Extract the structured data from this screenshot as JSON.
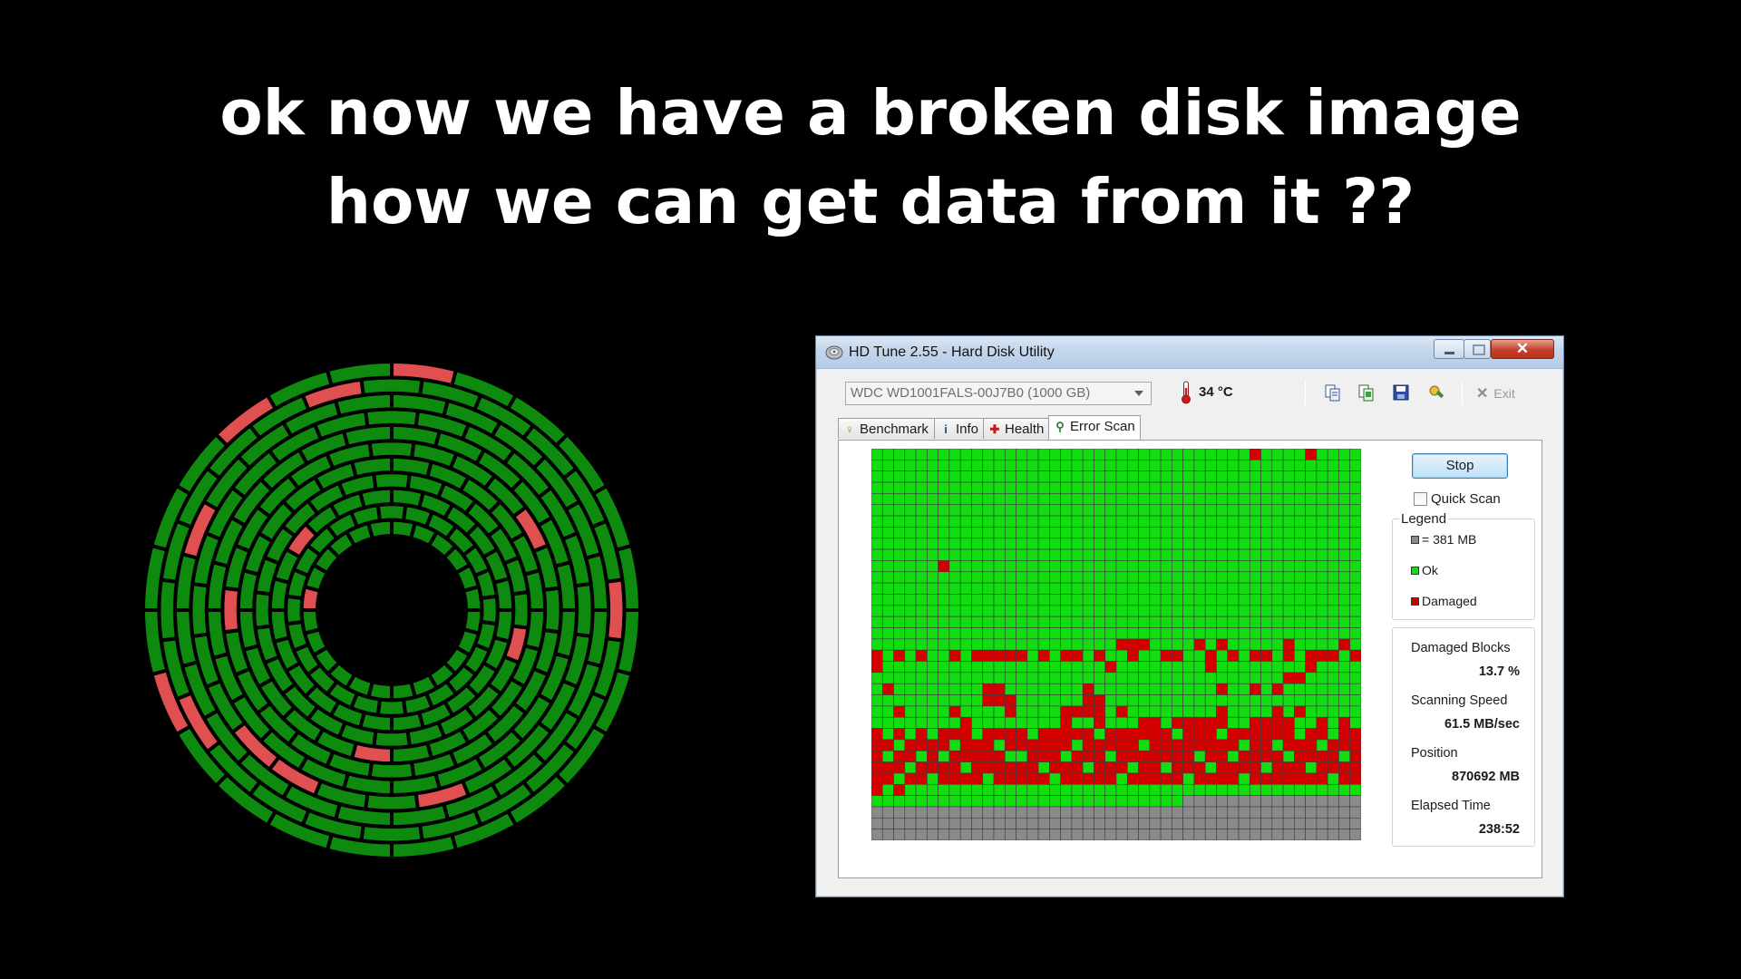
{
  "headline": {
    "line1": "ok now we have a broken disk image",
    "line2": "how we can get data from it ??"
  },
  "colors": {
    "background": "#000000",
    "disk_ok": "#0e8a0e",
    "disk_damaged": "#e05050",
    "disk_border": "#000000",
    "grid_ok": "#11dd11",
    "grid_damaged": "#d40000",
    "grid_unscanned": "#8a8a8a"
  },
  "disk_illustration": {
    "rings": 11,
    "sectors_per_ring": 24,
    "damaged_sectors": [
      [
        10,
        21
      ],
      [
        10,
        0
      ],
      [
        9,
        5
      ],
      [
        7,
        10
      ],
      [
        5,
        3
      ],
      [
        3,
        6
      ],
      [
        4,
        12
      ],
      [
        7,
        13
      ],
      [
        0,
        18
      ],
      [
        2,
        20
      ],
      [
        7,
        14
      ],
      [
        9,
        15
      ],
      [
        10,
        16
      ],
      [
        5,
        17
      ],
      [
        8,
        19
      ],
      [
        9,
        22
      ]
    ]
  },
  "window": {
    "title": "HD Tune 2.55 - Hard Disk Utility",
    "close_symbol": "✕",
    "drive": "WDC WD1001FALS-00J7B0 (1000 GB)",
    "temperature": "34 °C",
    "toolbar_icons": [
      "copy-text-icon",
      "copy-screenshot-icon",
      "save-icon",
      "options-icon"
    ],
    "exit_label": "Exit",
    "tabs": [
      {
        "label": "Benchmark",
        "icon": "benchmark-icon",
        "glyph": "♀"
      },
      {
        "label": "Info",
        "icon": "info-icon",
        "glyph": "i"
      },
      {
        "label": "Health",
        "icon": "health-icon",
        "glyph": "✚"
      },
      {
        "label": "Error Scan",
        "icon": "error-scan-icon",
        "glyph": "⚲"
      }
    ],
    "active_tab": "Error Scan",
    "stop_label": "Stop",
    "quick_scan_label": "Quick Scan",
    "quick_scan_checked": false,
    "legend": {
      "title": "Legend",
      "block_size": "= 381 MB",
      "ok": "Ok",
      "damaged": "Damaged"
    },
    "stats": {
      "damaged_blocks_label": "Damaged Blocks",
      "damaged_blocks_value": "13.7 %",
      "scanning_speed_label": "Scanning Speed",
      "scanning_speed_value": "61.5 MB/sec",
      "position_label": "Position",
      "position_value": "870692 MB",
      "elapsed_time_label": "Elapsed Time",
      "elapsed_time_value": "238:52"
    },
    "scan_grid": {
      "columns": 44,
      "rows": 35,
      "unscanned_from_row": 32,
      "unscanned_from_col_row31": 28,
      "damaged_cells": [
        [
          0,
          34
        ],
        [
          0,
          39
        ],
        [
          10,
          6
        ],
        [
          17,
          22
        ],
        [
          17,
          23
        ],
        [
          17,
          24
        ],
        [
          17,
          29
        ],
        [
          17,
          31
        ],
        [
          17,
          37
        ],
        [
          17,
          42
        ],
        [
          18,
          0
        ],
        [
          18,
          2
        ],
        [
          18,
          4
        ],
        [
          18,
          7
        ],
        [
          18,
          9
        ],
        [
          18,
          10
        ],
        [
          18,
          11
        ],
        [
          18,
          12
        ],
        [
          18,
          13
        ],
        [
          18,
          15
        ],
        [
          18,
          17
        ],
        [
          18,
          18
        ],
        [
          18,
          20
        ],
        [
          18,
          23
        ],
        [
          18,
          26
        ],
        [
          18,
          27
        ],
        [
          18,
          30
        ],
        [
          18,
          32
        ],
        [
          18,
          34
        ],
        [
          18,
          35
        ],
        [
          18,
          37
        ],
        [
          18,
          39
        ],
        [
          18,
          40
        ],
        [
          18,
          41
        ],
        [
          18,
          43
        ],
        [
          19,
          0
        ],
        [
          19,
          21
        ],
        [
          19,
          30
        ],
        [
          19,
          39
        ],
        [
          20,
          37
        ],
        [
          20,
          38
        ],
        [
          21,
          1
        ],
        [
          21,
          10
        ],
        [
          21,
          11
        ],
        [
          21,
          19
        ],
        [
          21,
          31
        ],
        [
          21,
          34
        ],
        [
          21,
          36
        ],
        [
          22,
          10
        ],
        [
          22,
          11
        ],
        [
          22,
          12
        ],
        [
          22,
          19
        ],
        [
          22,
          20
        ],
        [
          23,
          2
        ],
        [
          23,
          7
        ],
        [
          23,
          12
        ],
        [
          23,
          17
        ],
        [
          23,
          18
        ],
        [
          23,
          19
        ],
        [
          23,
          20
        ],
        [
          23,
          22
        ],
        [
          23,
          31
        ],
        [
          23,
          36
        ],
        [
          23,
          38
        ],
        [
          24,
          8
        ],
        [
          24,
          17
        ],
        [
          24,
          20
        ],
        [
          24,
          24
        ],
        [
          24,
          25
        ],
        [
          24,
          27
        ],
        [
          24,
          28
        ],
        [
          24,
          29
        ],
        [
          24,
          30
        ],
        [
          24,
          31
        ],
        [
          24,
          34
        ],
        [
          24,
          35
        ],
        [
          24,
          36
        ],
        [
          24,
          37
        ],
        [
          24,
          40
        ],
        [
          24,
          42
        ]
      ],
      "heavy_band_rows": [
        25,
        26,
        27,
        28,
        29
      ],
      "heavy_band_ok_cells": [
        [
          25,
          1
        ],
        [
          25,
          3
        ],
        [
          25,
          5
        ],
        [
          25,
          9
        ],
        [
          25,
          14
        ],
        [
          25,
          20
        ],
        [
          25,
          27
        ],
        [
          25,
          31
        ],
        [
          25,
          38
        ],
        [
          25,
          41
        ],
        [
          26,
          2
        ],
        [
          26,
          7
        ],
        [
          26,
          11
        ],
        [
          26,
          18
        ],
        [
          26,
          24
        ],
        [
          26,
          33
        ],
        [
          26,
          36
        ],
        [
          26,
          40
        ],
        [
          27,
          1
        ],
        [
          27,
          4
        ],
        [
          27,
          6
        ],
        [
          27,
          12
        ],
        [
          27,
          13
        ],
        [
          27,
          17
        ],
        [
          27,
          21
        ],
        [
          27,
          29
        ],
        [
          27,
          32
        ],
        [
          27,
          37
        ],
        [
          27,
          42
        ],
        [
          28,
          3
        ],
        [
          28,
          8
        ],
        [
          28,
          15
        ],
        [
          28,
          19
        ],
        [
          28,
          23
        ],
        [
          28,
          26
        ],
        [
          28,
          30
        ],
        [
          28,
          35
        ],
        [
          28,
          39
        ],
        [
          29,
          2
        ],
        [
          29,
          5
        ],
        [
          29,
          10
        ],
        [
          29,
          16
        ],
        [
          29,
          22
        ],
        [
          29,
          28
        ],
        [
          29,
          33
        ],
        [
          29,
          41
        ]
      ],
      "after_band_damaged": [
        [
          30,
          0
        ],
        [
          30,
          2
        ]
      ]
    }
  }
}
